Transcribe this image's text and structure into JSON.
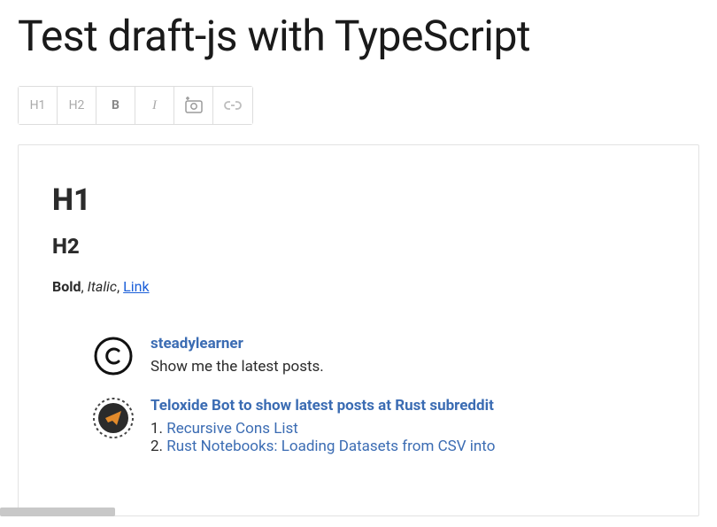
{
  "page_title": "Test draft-js with TypeScript",
  "toolbar": {
    "h1": "H1",
    "h2": "H2",
    "bold": "B",
    "italic": "I"
  },
  "editor": {
    "h1": "H1",
    "h2": "H2",
    "bold_text": "Bold",
    "sep1": ", ",
    "italic_text": "Italic",
    "sep2": ", ",
    "link_text": "Link"
  },
  "posts": {
    "user_row": {
      "username": "steadylearner",
      "message": "Show me the latest posts."
    },
    "bot_row": {
      "title": "Teloxide Bot to show latest posts at Rust subreddit",
      "items": [
        {
          "num": "1.",
          "text": "Recursive Cons List"
        },
        {
          "num": "2.",
          "text": "Rust Notebooks: Loading Datasets from CSV into"
        }
      ]
    }
  }
}
